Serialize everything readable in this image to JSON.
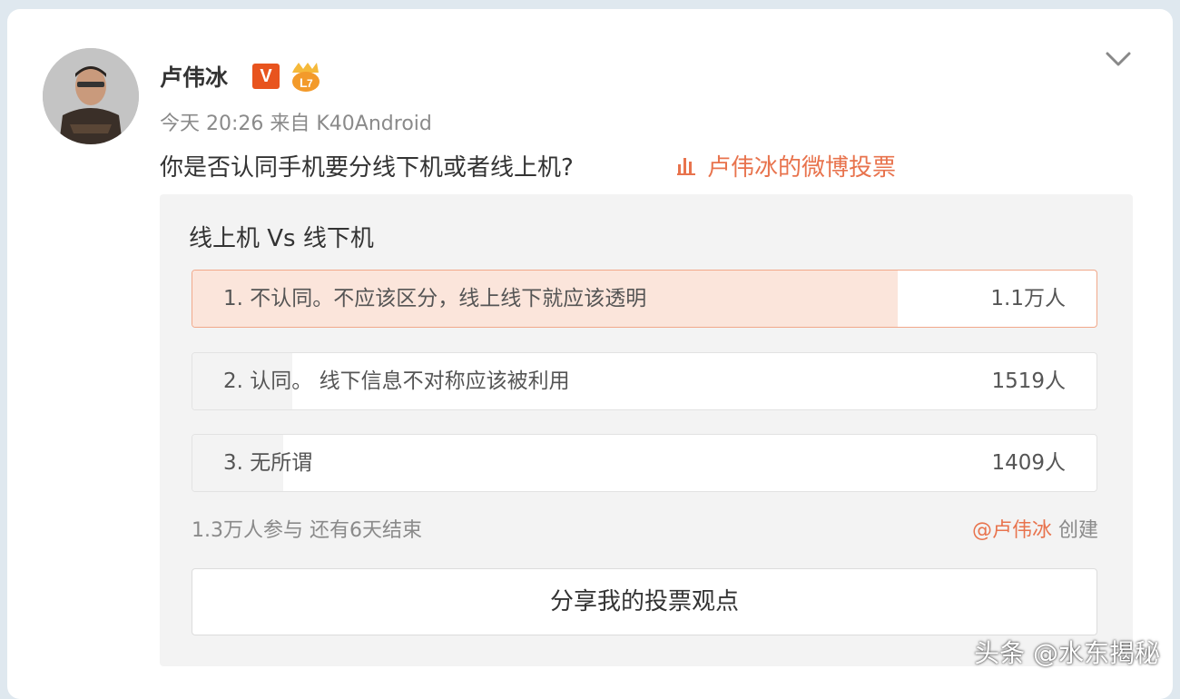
{
  "post": {
    "author": "卢伟冰",
    "verified_badge": "V",
    "level_badge_icon": "level-badge-icon",
    "meta": "今天 20:26 来自 K40Android",
    "text": "你是否认同手机要分线下机或者线上机?",
    "poll_link": "卢伟冰的微博投票"
  },
  "poll": {
    "title": "线上机 Vs 线下机",
    "options": [
      {
        "label": "1. 不认同。不应该区分，线上线下就应该透明",
        "count": "1.1万人",
        "share": 0.78,
        "fill_color": "#fbe5db",
        "selected": true
      },
      {
        "label": "2. 认同。 线下信息不对称应该被利用",
        "count": "1519人",
        "share": 0.11,
        "fill_color": "#f3f3f3",
        "selected": false
      },
      {
        "label": "3. 无所谓",
        "count": "1409人",
        "share": 0.1,
        "fill_color": "#f3f3f3",
        "selected": false
      }
    ],
    "stats": "1.3万人参与 还有6天结束",
    "creator_handle": "@卢伟冰",
    "creator_suffix": " 创建",
    "share_button": "分享我的投票观点"
  },
  "watermark": "头条 @水东揭秘",
  "colors": {
    "accent": "#e8734d",
    "verified": "#e8541e"
  }
}
